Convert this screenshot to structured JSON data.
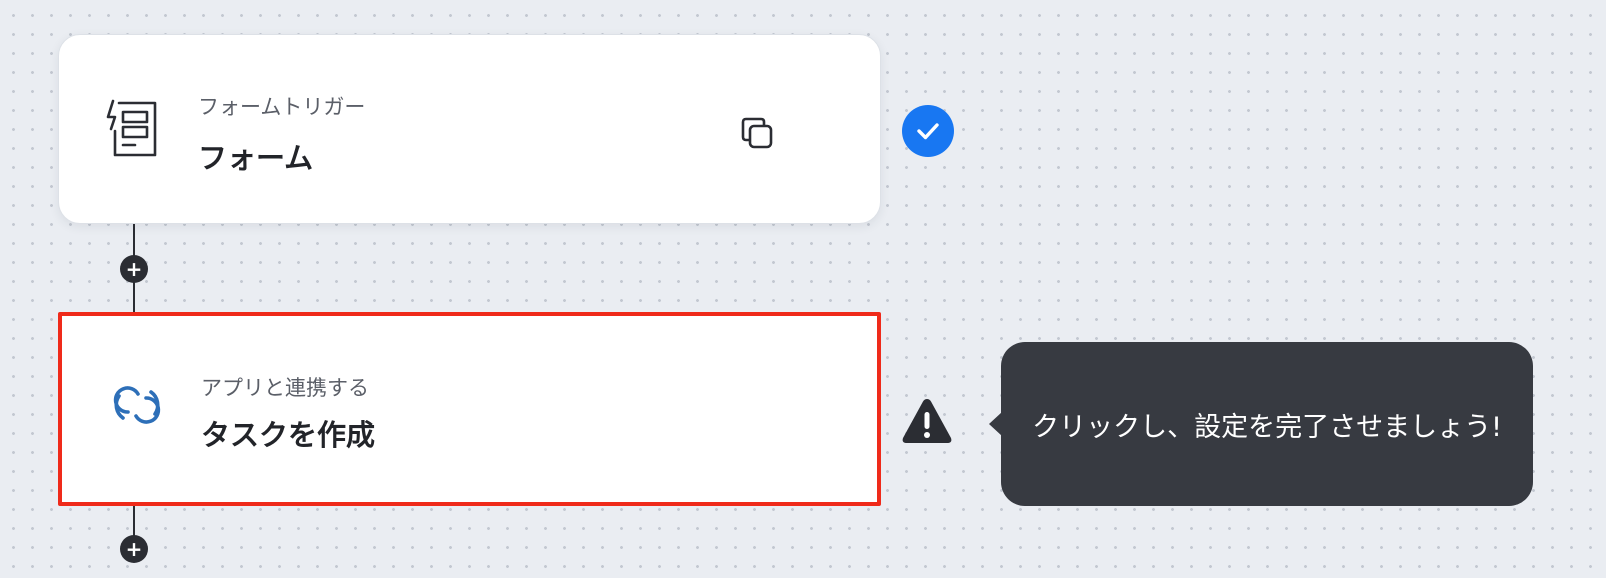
{
  "flow": {
    "trigger": {
      "subtitle": "フォームトリガー",
      "title": "フォーム",
      "icon": "form-trigger-icon",
      "status": "complete",
      "status_color": "#1877f2"
    },
    "action": {
      "subtitle": "アプリと連携する",
      "title": "タスクを作成",
      "icon": "app-link-icon",
      "icon_color": "#2d6fb8",
      "status": "warning",
      "highlight_color": "#ef2a1a"
    },
    "add_step_symbol": "+",
    "tooltip": {
      "text": "クリックし、設定を完了させましょう!"
    }
  }
}
